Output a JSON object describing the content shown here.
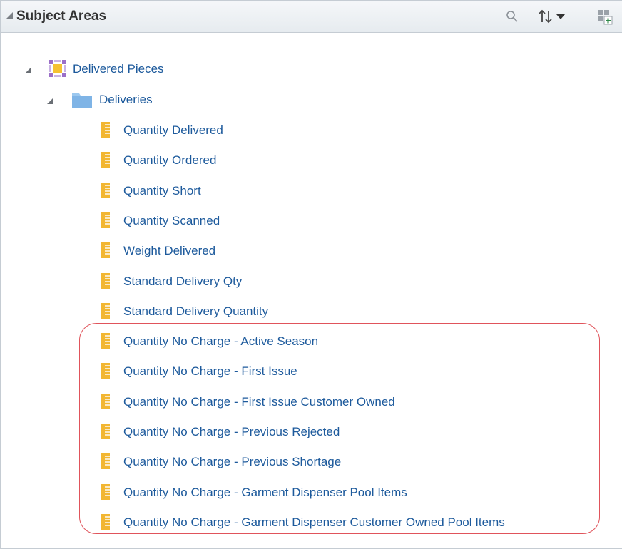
{
  "panel": {
    "title": "Subject Areas"
  },
  "toolbar": {
    "icons": [
      "search-icon",
      "sort-icon",
      "chevron-down-icon",
      "add-subject-area-icon"
    ]
  },
  "tree": {
    "subject_area": {
      "label": "Delivered Pieces",
      "icon": "subject-area-icon",
      "folder": {
        "label": "Deliveries",
        "icon": "folder-icon",
        "items": [
          "Quantity Delivered",
          "Quantity Ordered",
          "Quantity Short",
          "Quantity Scanned",
          "Weight Delivered",
          "Standard Delivery Qty",
          "Standard Delivery Quantity",
          "Quantity No Charge - Active Season",
          "Quantity No Charge - First Issue",
          "Quantity No Charge - First Issue Customer Owned",
          "Quantity No Charge - Previous Rejected",
          "Quantity No Charge - Previous Shortage",
          "Quantity No Charge - Garment Dispenser Pool Items",
          "Quantity No Charge - Garment Dispenser Customer Owned Pool Items"
        ]
      }
    }
  },
  "colors": {
    "link": "#1d5a9c",
    "measure_icon": "#f2b632",
    "highlight_border": "#e0545b"
  }
}
